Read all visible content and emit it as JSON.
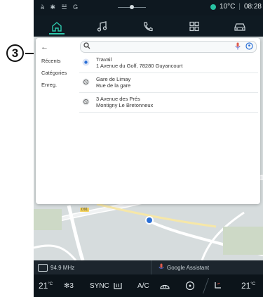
{
  "status": {
    "left_icons": "à ✱ ☱ G",
    "temperature": "10°C",
    "separator": "|",
    "time": "08:28"
  },
  "nav": {
    "tabs": [
      {
        "icon": "home-icon",
        "active": true
      },
      {
        "icon": "music-icon",
        "active": false
      },
      {
        "icon": "phone-icon",
        "active": false
      },
      {
        "icon": "apps-icon",
        "active": false
      },
      {
        "icon": "car-icon",
        "active": false
      }
    ]
  },
  "search": {
    "placeholder": "",
    "value": ""
  },
  "sidebar": {
    "items": [
      {
        "label": "Récents"
      },
      {
        "label": "Catégories"
      },
      {
        "label": "Enreg."
      }
    ]
  },
  "results": [
    {
      "line1": "Travail",
      "line2": "1 Avenue du Golf, 78280 Guyancourt",
      "icon": "work-pin-icon"
    },
    {
      "line1": "Gare de Limay",
      "line2": "Rue de la gare",
      "icon": "history-icon"
    },
    {
      "line1": "3 Avenue des Prés",
      "line2": "Montigny Le Bretonneux",
      "icon": "history-icon"
    }
  ],
  "map": {
    "road_label": "D91"
  },
  "bottom": {
    "radio": "94.9 MHz",
    "assistant": "Google Assistant"
  },
  "climate": {
    "left_temp": "21",
    "left_unit": "°C",
    "fan_level": "3",
    "sync": "SYNC",
    "ac": "A/C",
    "right_temp": "21",
    "right_unit": "°C"
  },
  "callout": {
    "number": "3"
  },
  "colors": {
    "accent": "#2ec9ad",
    "panel": "#ffffff",
    "map_bg": "#d6dcdd",
    "dark_bar": "#0c141a"
  }
}
